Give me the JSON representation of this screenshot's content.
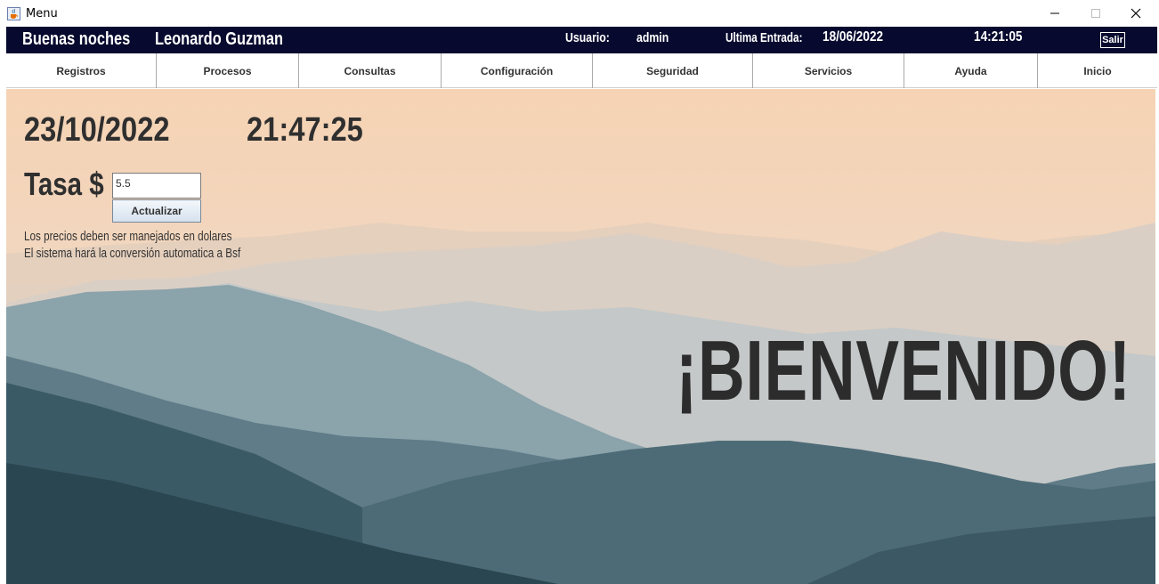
{
  "window": {
    "title": "Menu",
    "icon": "java-cup-icon",
    "controls": [
      "minimize-icon",
      "maximize-icon",
      "close-icon"
    ]
  },
  "header": {
    "greeting": "Buenas noches",
    "user_full_name": "Leonardo Guzman",
    "usuario_label": "Usuario:",
    "usuario_value": "admin",
    "ultima_entrada_label": "Ultima Entrada:",
    "ultima_entrada_date": "18/06/2022",
    "ultima_entrada_time": "14:21:05",
    "salir_label": "Salir",
    "background_color": "#07092e"
  },
  "menu": {
    "items": [
      {
        "label": "Registros"
      },
      {
        "label": "Procesos"
      },
      {
        "label": "Consultas"
      },
      {
        "label": "Configuración"
      },
      {
        "label": "Seguridad"
      },
      {
        "label": "Servicios"
      },
      {
        "label": "Ayuda"
      },
      {
        "label": "Inicio"
      }
    ]
  },
  "main": {
    "current_date": "23/10/2022",
    "current_time": "21:47:25",
    "tasa_label": "Tasa $",
    "tasa_value": "5.5",
    "actualizar_label": "Actualizar",
    "note_line1": "Los precios deben ser manejados en dolares",
    "note_line2": "El sistema hará la conversión automatica a Bsf",
    "welcome": "¡BIENVENIDO!"
  }
}
